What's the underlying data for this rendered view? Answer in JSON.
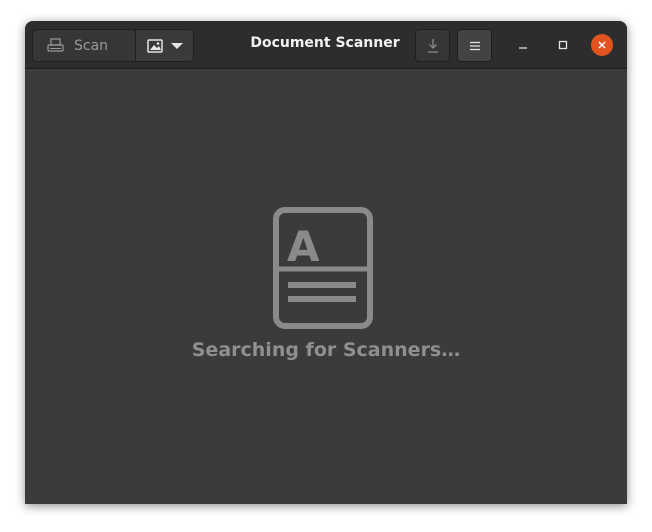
{
  "window": {
    "title": "Document Scanner"
  },
  "toolbar": {
    "scan_label": "Scan"
  },
  "status": {
    "message": "Searching for Scanners…"
  },
  "colors": {
    "close_button": "#e1531f",
    "header_bg": "#2d2d2d",
    "content_bg": "#3b3b3b",
    "status_text": "#8f8f8f"
  },
  "icons": [
    "scanner-icon",
    "photo-icon",
    "dropdown-arrow-icon",
    "save-icon",
    "hamburger-menu-icon",
    "minimize-icon",
    "maximize-icon",
    "close-icon",
    "document-placeholder-icon"
  ]
}
